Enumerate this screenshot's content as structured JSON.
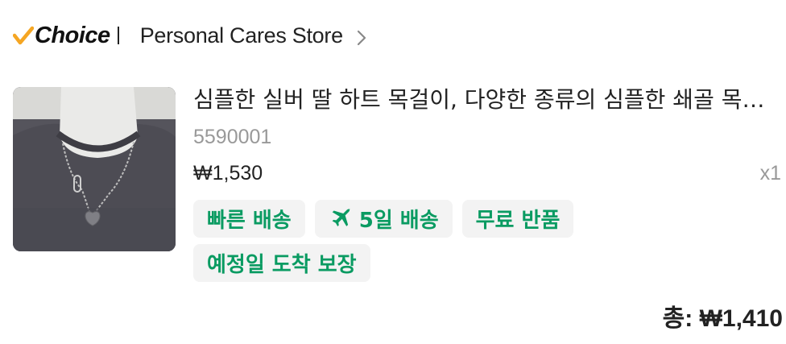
{
  "brand": {
    "logo_text": "Choice",
    "check_color": "#f5a623"
  },
  "store": {
    "name": "Personal Cares Store",
    "chevron_icon": "chevron-right-icon"
  },
  "product": {
    "title": "심플한 실버 딸 하트 목걸이, 다양한 종류의 심플한 쇄골 목걸이",
    "sku": "5590001",
    "price": "₩1,530",
    "quantity": "x1",
    "tags": [
      {
        "label": "빠른 배송"
      },
      {
        "label": "5일 배송",
        "icon": "airplane-icon"
      },
      {
        "label": "무료 반품"
      },
      {
        "label": "예정일 도착 보장"
      }
    ],
    "tag_text_color": "#0a9b62"
  },
  "order": {
    "total": "총: ₩1,410"
  }
}
